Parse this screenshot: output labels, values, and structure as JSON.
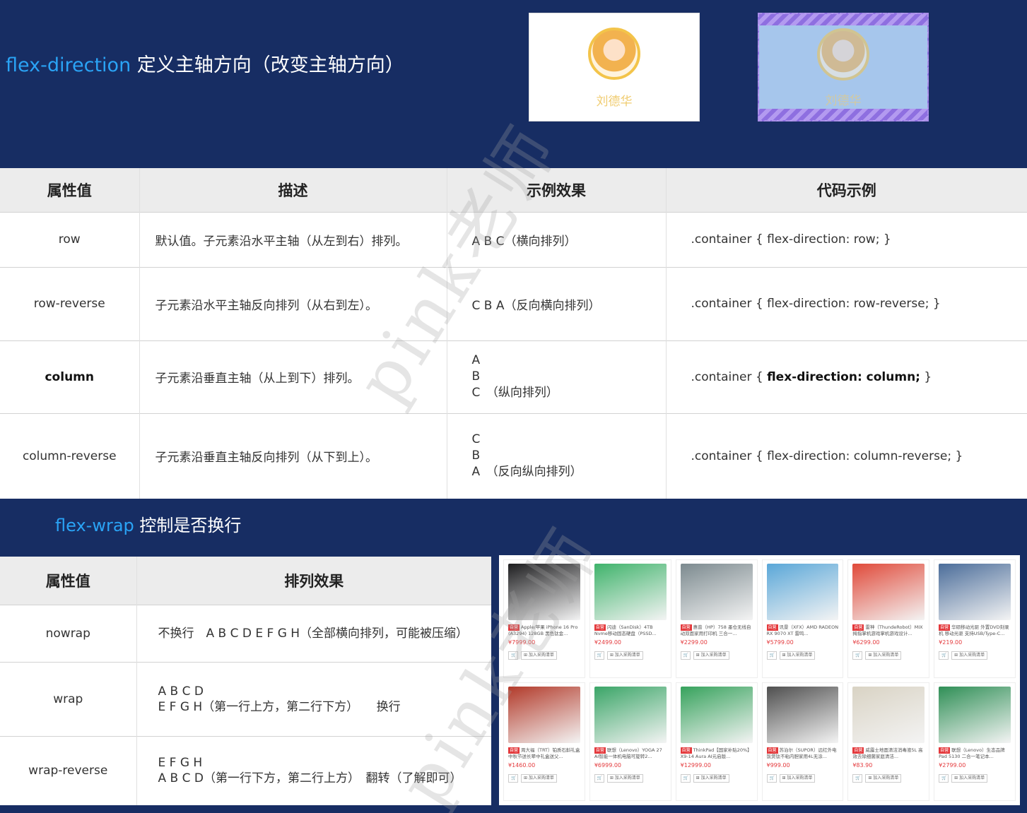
{
  "section1": {
    "keyword": "flex-direction",
    "title_rest": " 定义主轴方向（改变主轴方向）"
  },
  "demo": {
    "name1": "刘德华",
    "name2": "刘德华"
  },
  "table1": {
    "headers": [
      "属性值",
      "描述",
      "示例效果",
      "代码示例"
    ],
    "rows": [
      {
        "value": "row",
        "desc": "默认值。子元素沿水平主轴（从左到右）排列。",
        "effect": [
          "A B C（横向排列）"
        ],
        "code": ".container { flex-direction: row; }"
      },
      {
        "value": "row-reverse",
        "desc": "子元素沿水平主轴反向排列（从右到左）。",
        "effect": [
          "C B A（反向横向排列）"
        ],
        "code": ".container { flex-direction: row-reverse; }"
      },
      {
        "value": "column",
        "desc": "子元素沿垂直主轴（从上到下）排列。",
        "effect": [
          "A",
          "B",
          "C　（纵向排列）"
        ],
        "code_prefix": ".container { ",
        "code_bold": "flex-direction: column;",
        "code_suffix": " }"
      },
      {
        "value": "column-reverse",
        "desc": "子元素沿垂直主轴反向排列（从下到上）。",
        "effect": [
          "C",
          "B",
          "A　（反向纵向排列）"
        ],
        "code": ".container { flex-direction: column-reverse; }"
      }
    ]
  },
  "section2": {
    "keyword": "flex-wrap",
    "title_rest": " 控制是否换行"
  },
  "table2": {
    "headers": [
      "属性值",
      "排列效果"
    ],
    "rows": [
      {
        "value": "nowrap",
        "lines": [
          "不换行　A B C D E F G H（全部横向排列，可能被压缩）"
        ]
      },
      {
        "value": "wrap",
        "lines": [
          "A B C D",
          "E F G H（第一行上方，第二行下方）　　换行"
        ]
      },
      {
        "value": "wrap-reverse",
        "lines": [
          "E F G H",
          "A B C D（第一行下方，第二行上方）　翻转（了解即可）"
        ]
      }
    ]
  },
  "products": [
    {
      "tag": "自营",
      "title": "Apple/苹果 iPhone 16 Pro (A3294) 128GB 黑色钛金...",
      "price": "¥7999.00",
      "color": "#1d1d1f"
    },
    {
      "tag": "自营",
      "title": "闪迪（SanDisk）4TB Nvme移动固态硬盘（PSSD...",
      "price": "¥2499.00",
      "color": "#3fb36b"
    },
    {
      "tag": "自营",
      "title": "惠普（HP）758 墨仓无线自动双面家用打印机 三合一...",
      "price": "¥2299.00",
      "color": "#7c8a8f"
    },
    {
      "tag": "自营",
      "title": "讯景（XFX）AMD RADEON RX 9070 XT 雷鸣...",
      "price": "¥5799.00",
      "color": "#5aa7d8"
    },
    {
      "tag": "自营",
      "title": "雷神（ThundeRobot）MIX 拇指掌机游戏掌机游戏设计...",
      "price": "¥6299.00",
      "color": "#e04a3a"
    },
    {
      "tag": "自营",
      "title": "华硕移动光驱 外置DVD刻录机 移动光驱 支持USB/Type-C...",
      "price": "¥219.00",
      "color": "#4b6d9a"
    },
    {
      "tag": "自营",
      "title": "周大福（TRT）铂质石斛礼盒中秋节送长辈中礼盒送父...",
      "price": "¥1460.00",
      "color": "#b23a2a"
    },
    {
      "tag": "自营",
      "title": "联想（Lenovo）YOGA 27 AI智能一体机电脑可旋转2...",
      "price": "¥6999.00",
      "color": "#3aa567"
    },
    {
      "tag": "自营",
      "title": "ThinkPad【国家补贴20%】X9-14 Aura AI元启版...",
      "price": "¥12999.00",
      "color": "#36a25c"
    },
    {
      "tag": "自营",
      "title": "苏泊尔（SUPOR）远红外电饭煲钛不粘内胆家用4L无涂...",
      "price": "¥999.00",
      "color": "#4f4f4f"
    },
    {
      "tag": "自营",
      "title": "威露士地面清洁消毒液5L 高效去除细菌家庭清洁...",
      "price": "¥83.90",
      "color": "#d9d3c4"
    },
    {
      "tag": "自营",
      "title": "联想（Lenovo）生态品牌 Pad 5130 二合一笔记本...",
      "price": "¥2799.00",
      "color": "#2f8f56"
    }
  ],
  "product_buttons": {
    "cart": "🛒",
    "add": "⊞ 加入采购清单"
  },
  "watermark": "pink老师"
}
